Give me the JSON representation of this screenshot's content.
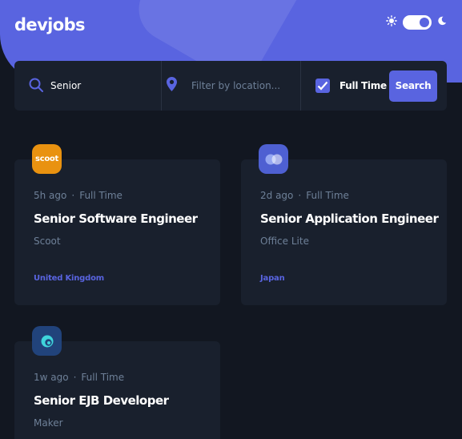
{
  "app": {
    "logo": "devjobs"
  },
  "theme_toggle": {
    "state": "dark",
    "icons": [
      "sun-icon",
      "moon-icon"
    ]
  },
  "search": {
    "title_value": "Senior",
    "location_placeholder": "Filter by location...",
    "full_time_checked": true,
    "full_time_label": "Full Time",
    "button_label": "Search"
  },
  "jobs": [
    {
      "posted": "5h ago",
      "contract": "Full Time",
      "title": "Senior Software Engineer",
      "company": "Scoot",
      "location": "United Kingdom",
      "logo_text": "scoot",
      "logo_bg": "#E99210"
    },
    {
      "posted": "2d ago",
      "contract": "Full Time",
      "title": "Senior Application Engineer",
      "company": "Office Lite",
      "location": "Japan",
      "logo_text": "",
      "logo_bg": "#4E60D2"
    },
    {
      "posted": "1w ago",
      "contract": "Full Time",
      "title": "Senior EJB Developer",
      "company": "Maker",
      "location": "",
      "logo_text": "",
      "logo_bg": "#21437B"
    }
  ],
  "colors": {
    "accent": "#5964E0",
    "background": "#121721",
    "card": "#19202D",
    "muted_text": "#6E8098"
  }
}
